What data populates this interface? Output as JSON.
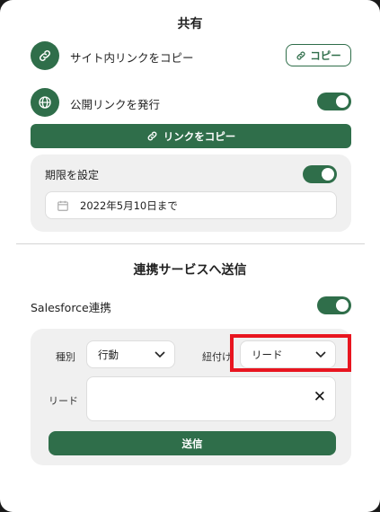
{
  "share": {
    "title": "共有",
    "internal_link": {
      "label": "サイト内リンクをコピー",
      "icon": "link-icon",
      "button_label": "コピー"
    },
    "public_link": {
      "label": "公開リンクを発行",
      "icon": "globe-icon",
      "enabled": true,
      "copy_button_label": "リンクをコピー"
    },
    "expiry": {
      "label": "期限を設定",
      "enabled": true,
      "date_value": "2022年5月10日まで",
      "icon": "calendar-icon"
    }
  },
  "integration": {
    "title": "連携サービスへ送信",
    "salesforce": {
      "label": "Salesforce連携",
      "enabled": true,
      "type_label": "種別",
      "type_value": "行動",
      "link_label": "紐付け",
      "link_value": "リード",
      "lead_label": "リード",
      "lead_value": "",
      "send_button_label": "送信"
    }
  },
  "colors": {
    "accent": "#2f6e4a",
    "highlight": "#e8151f"
  }
}
